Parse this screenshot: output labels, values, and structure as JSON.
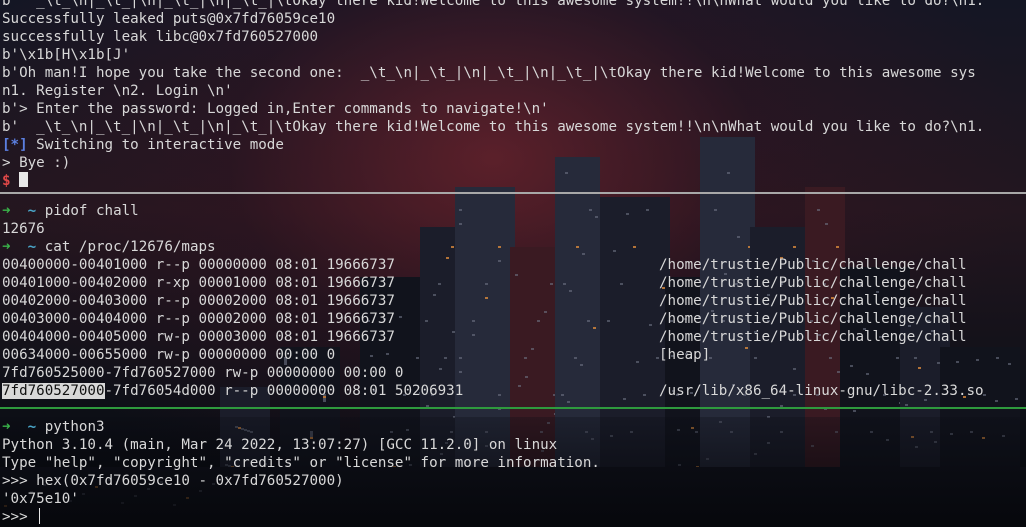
{
  "top_pane": {
    "lines": [
      "b'  _\\t_\\n|_\\t_|\\n|_\\t_|\\n|_\\t_|\\tOkay there kid!Welcome to this awesome system!!\\n\\nWhat would you like to do?\\n1.",
      "Successfully leaked puts@0x7fd76059ce10",
      "successfully leak libc@0x7fd760527000",
      "b'\\x1b[H\\x1b[J'",
      "b'Oh man!I hope you take the second one:  _\\t_\\n|_\\t_|\\n|_\\t_|\\n|_\\t_|\\tOkay there kid!Welcome to this awesome sys",
      "n1. Register \\n2. Login \\n'",
      "b'> Enter the password: Logged in,Enter commands to navigate!\\n'",
      "b'  _\\t_\\n|_\\t_|\\n|_\\t_|\\n|_\\t_|\\tOkay there kid!Welcome to this awesome system!!\\n\\nWhat would you like to do?\\n1."
    ],
    "status_bracket_open": "[",
    "status_star": "*",
    "status_bracket_close": "]",
    "status_text": " Switching to interactive mode",
    "bye_line": "> Bye :)",
    "prompt_symbol": "$"
  },
  "middle_pane": {
    "prompt_arrow": "➜",
    "prompt_dir": "~",
    "cmd1": "pidof chall",
    "pid": "12676",
    "cmd2": "cat /proc/12676/maps",
    "maps": [
      {
        "left": "00400000-00401000 r--p 00000000 08:01 19666737",
        "path": "/home/trustie/Public/challenge/chall"
      },
      {
        "left": "00401000-00402000 r-xp 00001000 08:01 19666737",
        "path": "/home/trustie/Public/challenge/chall"
      },
      {
        "left": "00402000-00403000 r--p 00002000 08:01 19666737",
        "path": "/home/trustie/Public/challenge/chall"
      },
      {
        "left": "00403000-00404000 r--p 00002000 08:01 19666737",
        "path": "/home/trustie/Public/challenge/chall"
      },
      {
        "left": "00404000-00405000 rw-p 00003000 08:01 19666737",
        "path": "/home/trustie/Public/challenge/chall"
      },
      {
        "left": "00634000-00655000 rw-p 00000000 00:00 0",
        "path": "[heap]"
      },
      {
        "left": "7fd760525000-7fd760527000 rw-p 00000000 00:00 0",
        "path": ""
      }
    ],
    "libc_selected": "7fd760527000",
    "libc_rest": "-7fd76054d000 r--p 00000000 08:01 50206931",
    "libc_path": "/usr/lib/x86_64-linux-gnu/libc-2.33.so"
  },
  "bottom_pane": {
    "prompt_arrow": "➜",
    "prompt_dir": "~",
    "cmd": "python3",
    "lines": [
      "Python 3.10.4 (main, Mar 24 2022, 13:07:27) [GCC 11.2.0] on linux",
      "Type \"help\", \"copyright\", \"credits\" or \"license\" for more information.",
      ">>> hex(0x7fd76059ce10 - 0x7fd760527000)",
      "'0x75e10'"
    ],
    "repl_prompt": ">>> "
  }
}
